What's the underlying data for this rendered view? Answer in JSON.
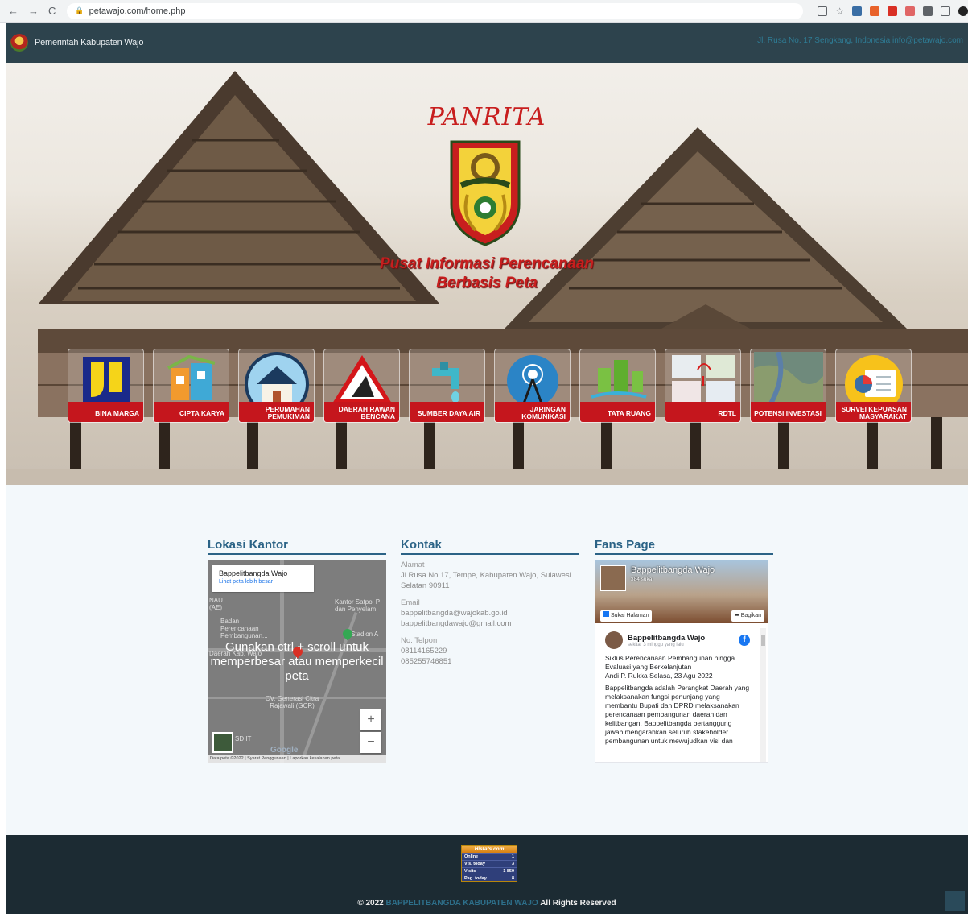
{
  "browser": {
    "url": "petawajo.com/home.php"
  },
  "nav": {
    "brand": "Pemerintah Kabupaten Wajo",
    "contact": "Jl. Rusa No. 17 Sengkang, Indonesia  info@petawajo.com"
  },
  "hero": {
    "title": "PANRITA",
    "tagline_1": "Pusat Informasi Perencanaan",
    "tagline_2": "Berbasis Peta",
    "tiles": [
      {
        "label": "BINA MARGA",
        "icon": "pu-logo-icon"
      },
      {
        "label": "CIPTA KARYA",
        "icon": "cipta-karya-icon"
      },
      {
        "label": "PERUMAHAN PEMUKIMAN",
        "icon": "house-icon"
      },
      {
        "label": "DAERAH RAWAN BENCANA",
        "icon": "hazard-icon"
      },
      {
        "label": "SUMBER DAYA AIR",
        "icon": "water-tap-icon"
      },
      {
        "label": "JARINGAN KOMUNIKASI",
        "icon": "antenna-icon"
      },
      {
        "label": "TATA RUANG",
        "icon": "city-plan-icon"
      },
      {
        "label": "RDTL",
        "icon": "map-sheets-icon"
      },
      {
        "label": "POTENSI INVESTASI",
        "icon": "satellite-map-icon"
      },
      {
        "label": "SURVEI KEPUASAN MASYARAKAT",
        "icon": "survey-chart-icon"
      }
    ]
  },
  "lokasi": {
    "heading": "Lokasi Kantor",
    "place_name": "Bappelitbangda Wajo",
    "view_larger": "Lihat peta lebih besar",
    "overlay": "Gunakan ctrl + scroll untuk memperbesar atau memperkecil peta",
    "poi_1": "Kantor Satpol P dan Penyelam",
    "poi_2": "Badan Perencanaan Pembangunan...",
    "poi_3": "Stadion A",
    "poi_4": "Daerah Kab. Wajo",
    "poi_5": "CV. Generasi Citra Rajawali (GCR)",
    "poi_6": "SD IT",
    "poi_7": "NAU (AE)",
    "zoom_in": "+",
    "zoom_out": "−",
    "google": "Google",
    "attribution": "Data peta ©2022 | Syarat Penggunaan | Laporkan kesalahan peta"
  },
  "kontak": {
    "heading": "Kontak",
    "alamat_label": "Alamat",
    "alamat": "Jl.Rusa No.17, Tempe, Kabupaten Wajo, Sulawesi Selatan 90911",
    "email_label": "Email",
    "email_1": "bappelitbangda@wajokab.go.id",
    "email_2": "bappelitbangdawajo@gmail.com",
    "telpon_label": "No. Telpon",
    "telpon_1": "08114165229",
    "telpon_2": "085255746851"
  },
  "fans": {
    "heading": "Fans Page",
    "page_name": "Bappelitbangda Wajo",
    "likes": "384 suka",
    "like_button": "Sukai Halaman",
    "share_button": "Bagikan",
    "post_author": "Bappelitbangda Wajo",
    "post_time": "sekitar 3 minggu yang lalu",
    "post_text_1": "Siklus Perencanaan Pembangunan hingga Evaluasi yang Berkelanjutan",
    "post_text_2": "Andi P. Rukka Selasa, 23 Agu 2022",
    "post_text_3": "Bappelitbangda adalah Perangkat Daerah yang melaksanakan fungsi penunjang yang membantu Bupati dan DPRD melaksanakan perencanaan pembangunan daerah dan kelitbangan. Bappelitbangda bertanggung jawab mengarahkan seluruh stakeholder pembangunan untuk mewujudkan visi dan"
  },
  "counter": {
    "title": "Histats.com",
    "rows": [
      {
        "k": "Online",
        "v": "1"
      },
      {
        "k": "Vis. today",
        "v": "3"
      },
      {
        "k": "Visits",
        "v": "1 859"
      },
      {
        "k": "Pag. today",
        "v": "8"
      }
    ]
  },
  "footer": {
    "prefix": "© 2022",
    "org": "BAPPELITBANGDA KABUPATEN WAJO",
    "suffix": "All Rights Reserved"
  }
}
